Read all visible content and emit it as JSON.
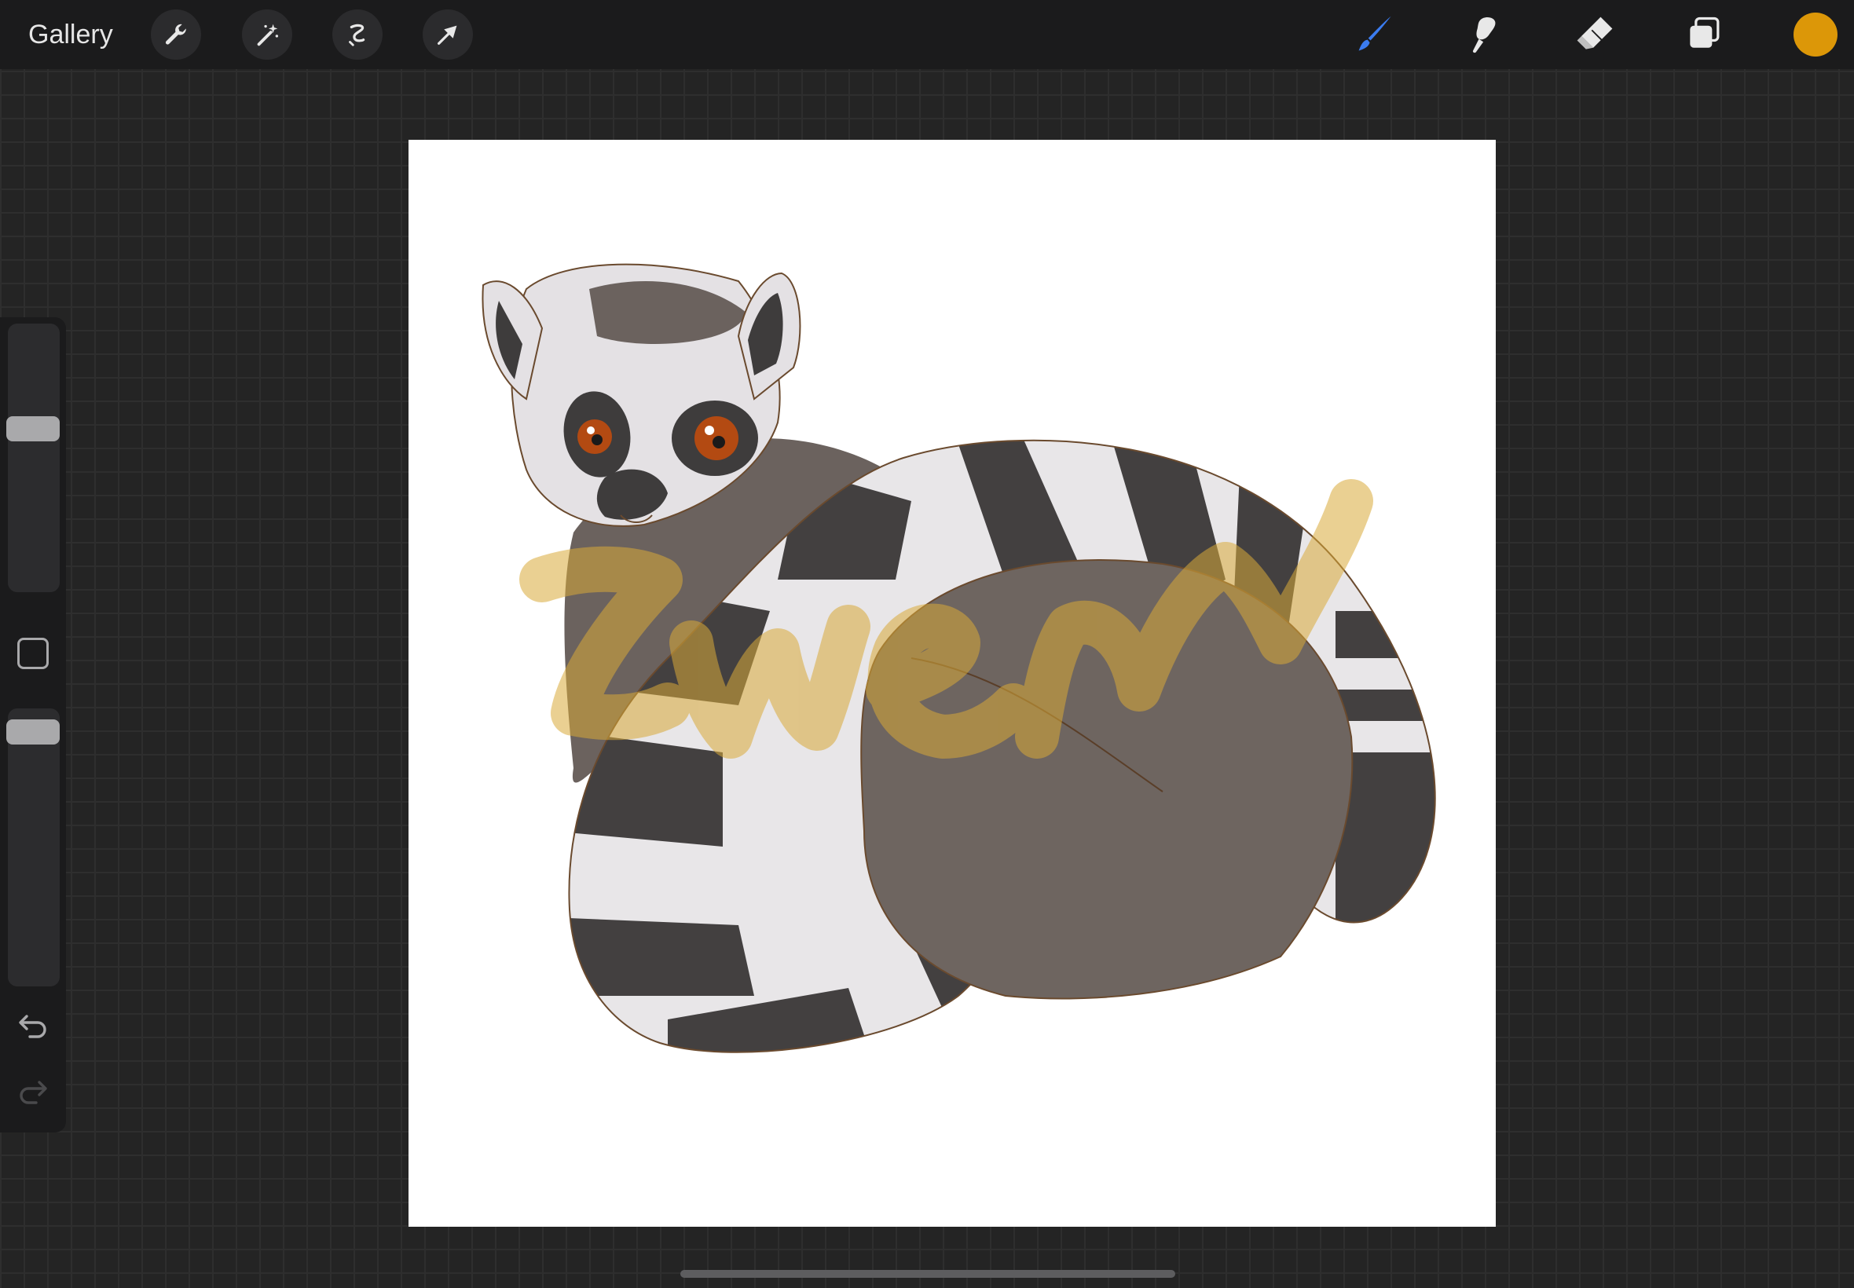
{
  "topbar": {
    "gallery_label": "Gallery",
    "left_tools": [
      "wrench-icon",
      "magic-wand-icon",
      "selection-icon",
      "move-arrow-icon"
    ],
    "right_tools": [
      "brush-icon",
      "smudge-icon",
      "eraser-icon",
      "layers-icon"
    ],
    "active_tool": "brush-icon",
    "accent_color": "#3b7cf0",
    "current_color": "#dc9708"
  },
  "sidebar": {
    "brush_size_level": 0.38,
    "opacity_level": 0.04,
    "buttons": [
      "modify-square-icon",
      "undo-icon",
      "redo-icon"
    ]
  },
  "canvas": {
    "background": "#ffffff",
    "artwork": "ring-tailed-lemur-illustration",
    "watermark_text": "Zwen"
  }
}
